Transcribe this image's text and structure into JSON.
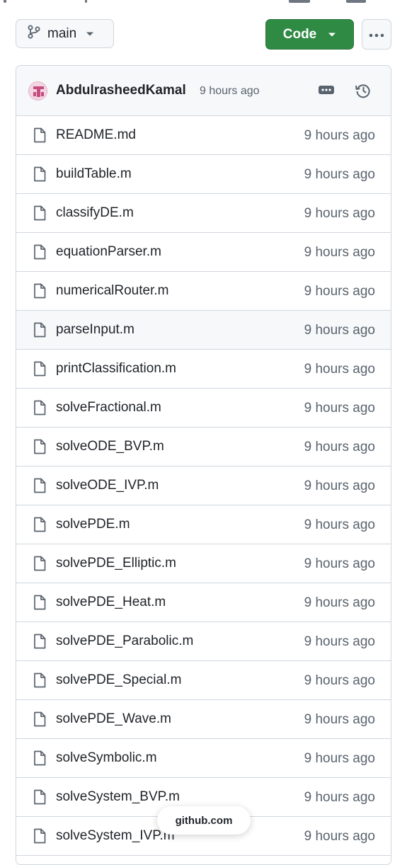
{
  "toolbar": {
    "branch_label": "main",
    "code_label": "Code",
    "code_color": "#2f8a44"
  },
  "commit": {
    "author": "AbdulrasheedKamal",
    "time": "9 hours ago"
  },
  "files": [
    {
      "name": "README.md",
      "age": "9 hours ago"
    },
    {
      "name": "buildTable.m",
      "age": "9 hours ago"
    },
    {
      "name": "classifyDE.m",
      "age": "9 hours ago"
    },
    {
      "name": "equationParser.m",
      "age": "9 hours ago"
    },
    {
      "name": "numericalRouter.m",
      "age": "9 hours ago"
    },
    {
      "name": "parseInput.m",
      "age": "9 hours ago"
    },
    {
      "name": "printClassification.m",
      "age": "9 hours ago"
    },
    {
      "name": "solveFractional.m",
      "age": "9 hours ago"
    },
    {
      "name": "solveODE_BVP.m",
      "age": "9 hours ago"
    },
    {
      "name": "solveODE_IVP.m",
      "age": "9 hours ago"
    },
    {
      "name": "solvePDE.m",
      "age": "9 hours ago"
    },
    {
      "name": "solvePDE_Elliptic.m",
      "age": "9 hours ago"
    },
    {
      "name": "solvePDE_Heat.m",
      "age": "9 hours ago"
    },
    {
      "name": "solvePDE_Parabolic.m",
      "age": "9 hours ago"
    },
    {
      "name": "solvePDE_Special.m",
      "age": "9 hours ago"
    },
    {
      "name": "solvePDE_Wave.m",
      "age": "9 hours ago"
    },
    {
      "name": "solveSymbolic.m",
      "age": "9 hours ago"
    },
    {
      "name": "solveSystem_BVP.m",
      "age": "9 hours ago"
    },
    {
      "name": "solveSystem_IVP.m",
      "age": "9 hours ago"
    }
  ],
  "footer": {
    "domain_label": "github.com"
  }
}
